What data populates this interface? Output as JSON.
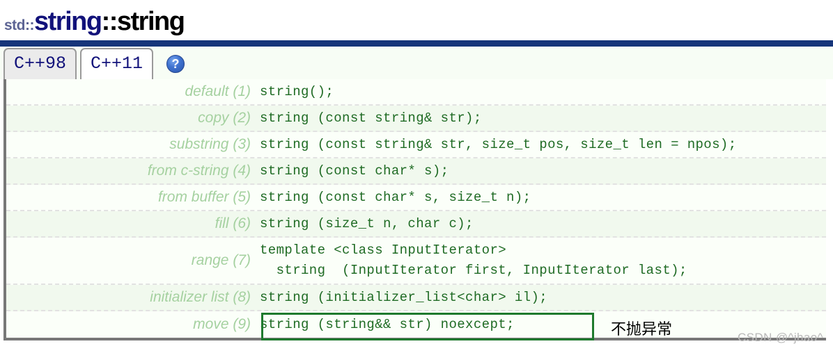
{
  "header": {
    "namespace": "std::",
    "class_name": "string",
    "separator": "::",
    "member_name": "string"
  },
  "tabs": [
    {
      "label": "C++98",
      "active": false
    },
    {
      "label": "C++11",
      "active": true
    }
  ],
  "help": {
    "icon": "question-mark-icon",
    "glyph": "?"
  },
  "signatures": [
    {
      "label": "default (1)",
      "code": "string();"
    },
    {
      "label": "copy (2)",
      "code": "string (const string& str);"
    },
    {
      "label": "substring (3)",
      "code": "string (const string& str, size_t pos, size_t len = npos);"
    },
    {
      "label": "from c-string (4)",
      "code": "string (const char* s);"
    },
    {
      "label": "from buffer (5)",
      "code": "string (const char* s, size_t n);"
    },
    {
      "label": "fill (6)",
      "code": "string (size_t n, char c);"
    },
    {
      "label": "range (7)",
      "code": "template <class InputIterator>\n  string  (InputIterator first, InputIterator last);"
    },
    {
      "label": "initializer list (8)",
      "code": "string (initializer_list<char> il);"
    },
    {
      "label": "move (9)",
      "code": "string (string&& str) noexcept;"
    }
  ],
  "annotation": {
    "move_note": "不抛异常"
  },
  "watermark": {
    "text": "CSDN @^jhao^"
  },
  "colors": {
    "title_class": "#12127a",
    "title_namespace": "#5d6494",
    "blue_rule": "#16357a",
    "code_text": "#1f6b24",
    "label_text": "#a5d1a0",
    "highlight_border": "#1f7a2e",
    "row_alt_bg": "#f1f9ee",
    "row_bg": "#fbfff9"
  }
}
